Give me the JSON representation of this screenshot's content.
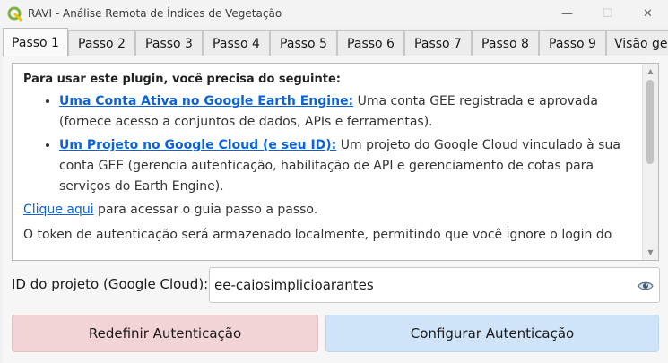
{
  "window": {
    "title": "RAVI - Análise Remota de Índices de Vegetação",
    "minimize_glyph": "—",
    "maximize_glyph": "☐",
    "close_glyph": "✕",
    "app_icon": "qgis-logo-icon",
    "brand_color": "#7cb342"
  },
  "tabs": [
    {
      "label": "Passo 1",
      "active": true
    },
    {
      "label": "Passo 2"
    },
    {
      "label": "Passo 3"
    },
    {
      "label": "Passo 4"
    },
    {
      "label": "Passo 5"
    },
    {
      "label": "Passo 6"
    },
    {
      "label": "Passo 7"
    },
    {
      "label": "Passo 8"
    },
    {
      "label": "Passo 9"
    },
    {
      "label": "Visão ge"
    }
  ],
  "content": {
    "intro": "Para usar este plugin, você precisa do seguinte:",
    "requirements": [
      {
        "link": "Uma Conta Ativa no Google Earth Engine:",
        "text": " Uma conta GEE registrada e aprovada (fornece acesso a conjuntos de dados, APIs e ferramentas)."
      },
      {
        "link": "Um Projeto no Google Cloud (e seu ID):",
        "text": " Um projeto do Google Cloud vinculado à sua conta GEE (gerencia autenticação, habilitação de API e gerenciamento de cotas para serviços do Earth Engine)."
      }
    ],
    "guide_link": "Clique aqui",
    "guide_text": " para acessar o guia passo a passo.",
    "token_text": "O token de autenticação será armazenado localmente, permitindo que você ignore o login do",
    "link_color": "#0b63d6"
  },
  "project_field": {
    "label": "ID do projeto (Google Cloud):",
    "value": "ee-caiosimplicioarantes",
    "toggle_icon": "eye-icon"
  },
  "buttons": {
    "reset_label": "Redefinir Autenticação",
    "reset_color": "#f3d4d6",
    "config_label": "Configurar Autenticação",
    "config_color": "#cfe4f8"
  }
}
